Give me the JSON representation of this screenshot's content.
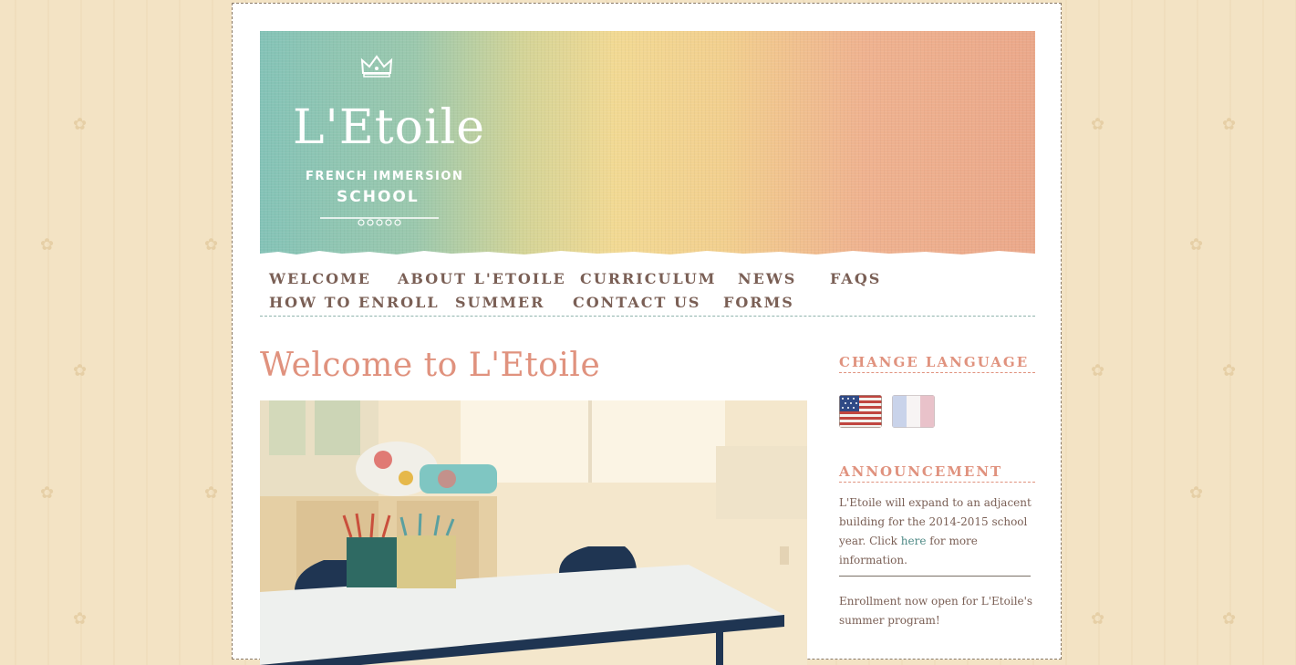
{
  "brand": {
    "name": "L'Etoile",
    "tagline_line1": "FRENCH IMMERSION",
    "tagline_line2": "SCHOOL"
  },
  "nav": {
    "items": [
      {
        "label": "WELCOME"
      },
      {
        "label": "ABOUT L'ETOILE"
      },
      {
        "label": "CURRICULUM"
      },
      {
        "label": "NEWS"
      },
      {
        "label": "FAQS"
      },
      {
        "label": "HOW TO ENROLL"
      },
      {
        "label": "SUMMER"
      },
      {
        "label": "CONTACT US"
      },
      {
        "label": "FORMS"
      }
    ]
  },
  "main": {
    "title": "Welcome to L'Etoile"
  },
  "sidebar": {
    "language_heading": "CHANGE LANGUAGE",
    "flags": [
      "us-flag-icon",
      "france-flag-icon"
    ],
    "announcement_heading": "ANNOUNCEMENT",
    "announcement_before_link": "L'Etoile will expand to an adjacent building for the 2014-2015 school year. Click ",
    "announcement_link": "here",
    "announcement_after_link": " for more information.",
    "enrollment_text": "Enrollment now open for L'Etoile's summer program!"
  },
  "colors": {
    "page_bg": "#f3e3c4",
    "nav_text": "#7a5f55",
    "accent_salmon": "#e0927e",
    "link_teal": "#4f8a86"
  }
}
